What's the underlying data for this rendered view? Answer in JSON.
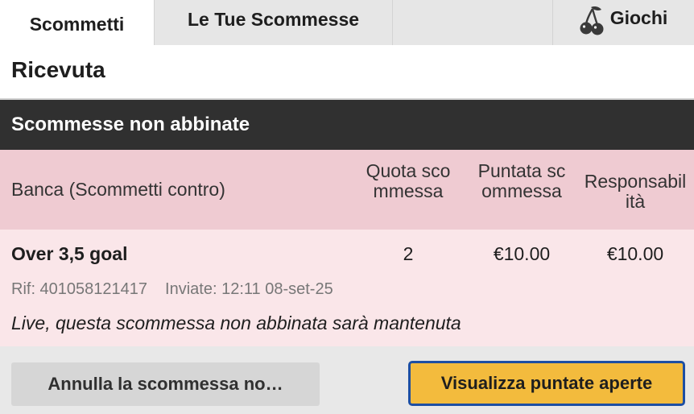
{
  "tabs": {
    "bets": "Scommetti",
    "my_bets": "Le Tue Scommesse",
    "games": "Giochi",
    "games_icon": "cherry-icon"
  },
  "receipt_title": "Ricevuta",
  "section_title": "Scommesse non abbinate",
  "columns": {
    "type_label": "Banca (Scommetti contro)",
    "odds": "Quota scommessa",
    "stake": "Puntata scommessa",
    "liability": "Responsabilità"
  },
  "bet": {
    "selection": "Over 3,5 goal",
    "odds": "2",
    "stake": "€10.00",
    "liability": "€10.00",
    "ref": "Rif: 401058121417",
    "sent": "Inviate: 12:11 08-set-25",
    "note": "Live, questa scommessa non abbinata sarà mantenuta"
  },
  "buttons": {
    "cancel": "Annulla la scommessa no…",
    "view_open": "Visualizza puntate aperte"
  },
  "colors": {
    "header_dark": "#303030",
    "column_header_bg": "#efcbd2",
    "row_bg": "#fae6e9",
    "primary_button": "#f3bb3d",
    "primary_button_border": "#1d4fa3"
  }
}
